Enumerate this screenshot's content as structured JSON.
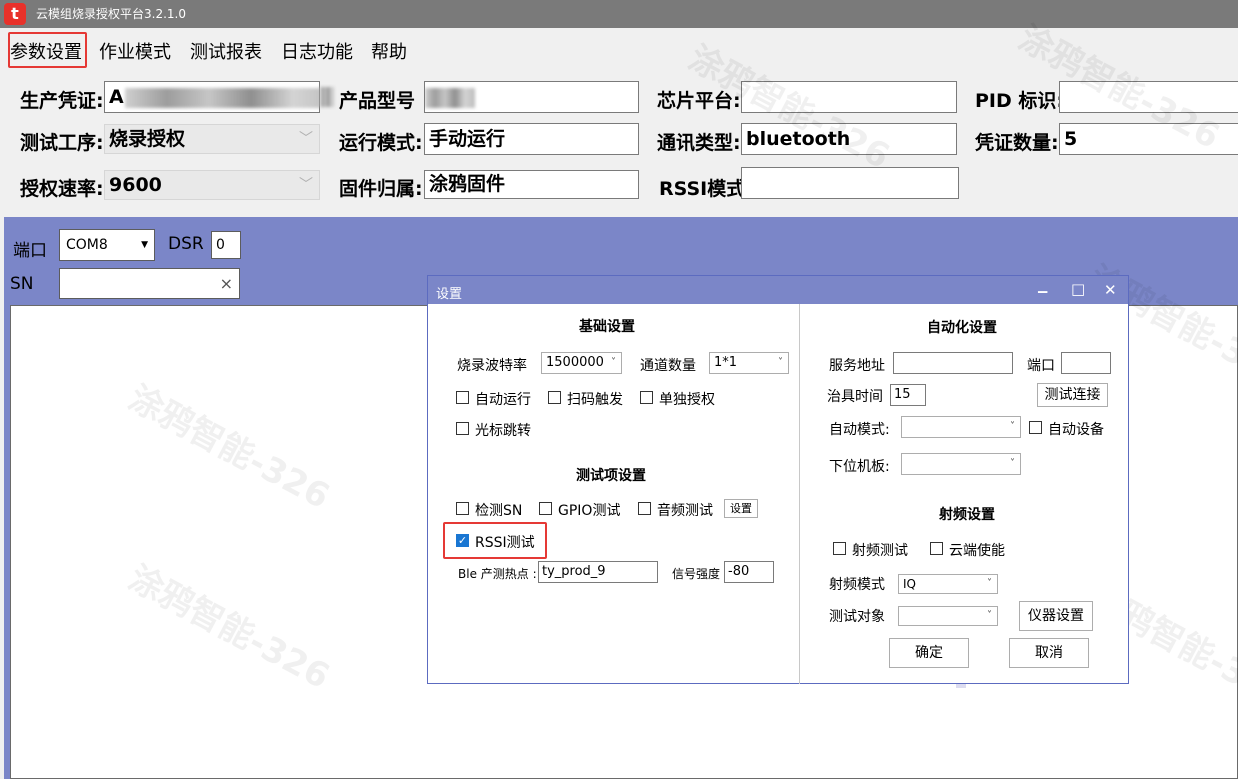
{
  "window": {
    "title": "云模组烧录授权平台3.2.1.0",
    "logo_glyph": "t"
  },
  "menu": [
    {
      "label": "参数设置"
    },
    {
      "label": "作业模式"
    },
    {
      "label": "测试报表"
    },
    {
      "label": "日志功能"
    },
    {
      "label": "帮助"
    }
  ],
  "form": {
    "production_cert_label": "生产凭证:",
    "production_cert_value": "A",
    "product_model_label": "产品型号",
    "chip_platform_label": "芯片平台:",
    "chip_platform_value": "",
    "pid_label": "PID 标识:",
    "pid_value": "",
    "test_process_label": "测试工序:",
    "test_process_value": "烧录授权",
    "run_mode_label": "运行模式:",
    "run_mode_value": "手动运行",
    "comm_type_label": "通讯类型:",
    "comm_type_value": "bluetooth",
    "cert_count_label": "凭证数量:",
    "cert_count_value": "5",
    "auth_rate_label": "授权速率:",
    "auth_rate_value": "9600",
    "firmware_owner_label": "固件归属:",
    "firmware_owner_value": "涂鸦固件",
    "rssi_mode_label": "RSSI模式",
    "rssi_mode_value": ""
  },
  "port_panel": {
    "port_label": "端口",
    "port_value": "COM8",
    "dsr_label": "DSR",
    "dsr_value": "0",
    "sn_label": "SN",
    "sn_value": "",
    "clear_glyph": "×"
  },
  "dialog": {
    "title": "设置",
    "minimize_glyph": "▁",
    "maximize_glyph": "□",
    "close_glyph": "✕",
    "basic": {
      "heading": "基础设置",
      "baud_label": "烧录波特率",
      "baud_value": "1500000",
      "channels_label": "通道数量",
      "channels_value": "1*1",
      "auto_run": "自动运行",
      "scan_trigger": "扫码触发",
      "single_auth": "单独授权",
      "cursor_jump": "光标跳转"
    },
    "test_items": {
      "heading": "测试项设置",
      "check_sn": "检测SN",
      "gpio_test": "GPIO测试",
      "audio_test": "音频测试",
      "settings_button": "设置",
      "rssi_test": "RSSI测试",
      "rssi_test_checked": true,
      "ble_hotspot_label": "Ble 产测热点 :",
      "ble_hotspot_value": "ty_prod_9",
      "signal_strength_label": "信号强度",
      "signal_strength_value": "-80"
    },
    "automation": {
      "heading": "自动化设置",
      "server_label": "服务地址",
      "server_value": "",
      "port_label": "端口",
      "port_value": "",
      "fixture_time_label": "治具时间",
      "fixture_time_value": "15",
      "test_connect_button": "测试连接",
      "auto_mode_label": "自动模式:",
      "auto_mode_value": "",
      "auto_device": "自动设备",
      "lower_board_label": "下位机板:",
      "lower_board_value": ""
    },
    "rf": {
      "heading": "射频设置",
      "rf_test": "射频测试",
      "cloud_enable": "云端使能",
      "rf_mode_label": "射频模式",
      "rf_mode_value": "IQ",
      "test_target_label": "测试对象",
      "test_target_value": "",
      "instrument_button": "仪器设置"
    },
    "ok_button": "确定",
    "cancel_button": "取消"
  },
  "watermark_text": "涂鸦智能-326",
  "colors": {
    "highlight": "#e53935",
    "panel": "#7b86c8",
    "checkbox_on": "#1976d2"
  }
}
